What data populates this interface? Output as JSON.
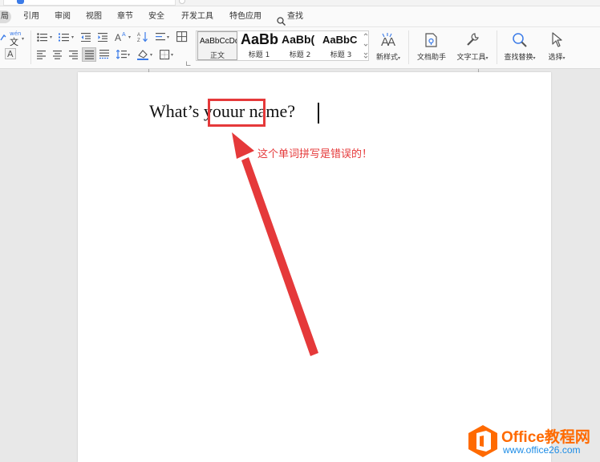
{
  "menu": {
    "items": [
      "局",
      "引用",
      "审阅",
      "视图",
      "章节",
      "安全",
      "开发工具",
      "特色应用",
      "查找"
    ]
  },
  "ribbon": {
    "phonetic": "wén",
    "phonetic_char": "文",
    "font_color_letter": "A",
    "styles": [
      {
        "sample": "AaBbCcDd",
        "name": "正文"
      },
      {
        "sample": "AaBb",
        "name": "标题 1"
      },
      {
        "sample": "AaBb(",
        "name": "标题 2"
      },
      {
        "sample": "AaBbC",
        "name": "标题 3"
      }
    ],
    "new_style": "新样式",
    "doc_assistant": "文档助手",
    "text_tools": "文字工具",
    "find_replace": "查找替换",
    "select": "选择"
  },
  "document": {
    "text_before": "What’s ",
    "highlighted_word": "youur",
    "text_after": " name?",
    "annotation": "这个单词拼写是错误的！"
  },
  "watermark": {
    "brand_en": "Office",
    "brand_cn": "教程网",
    "url": "www.office26.com"
  },
  "colors": {
    "accent_blue": "#3b7be8",
    "annotation_red": "#e5393a",
    "logo_orange": "#ff6a00",
    "logo_blue": "#1c8ce6"
  }
}
